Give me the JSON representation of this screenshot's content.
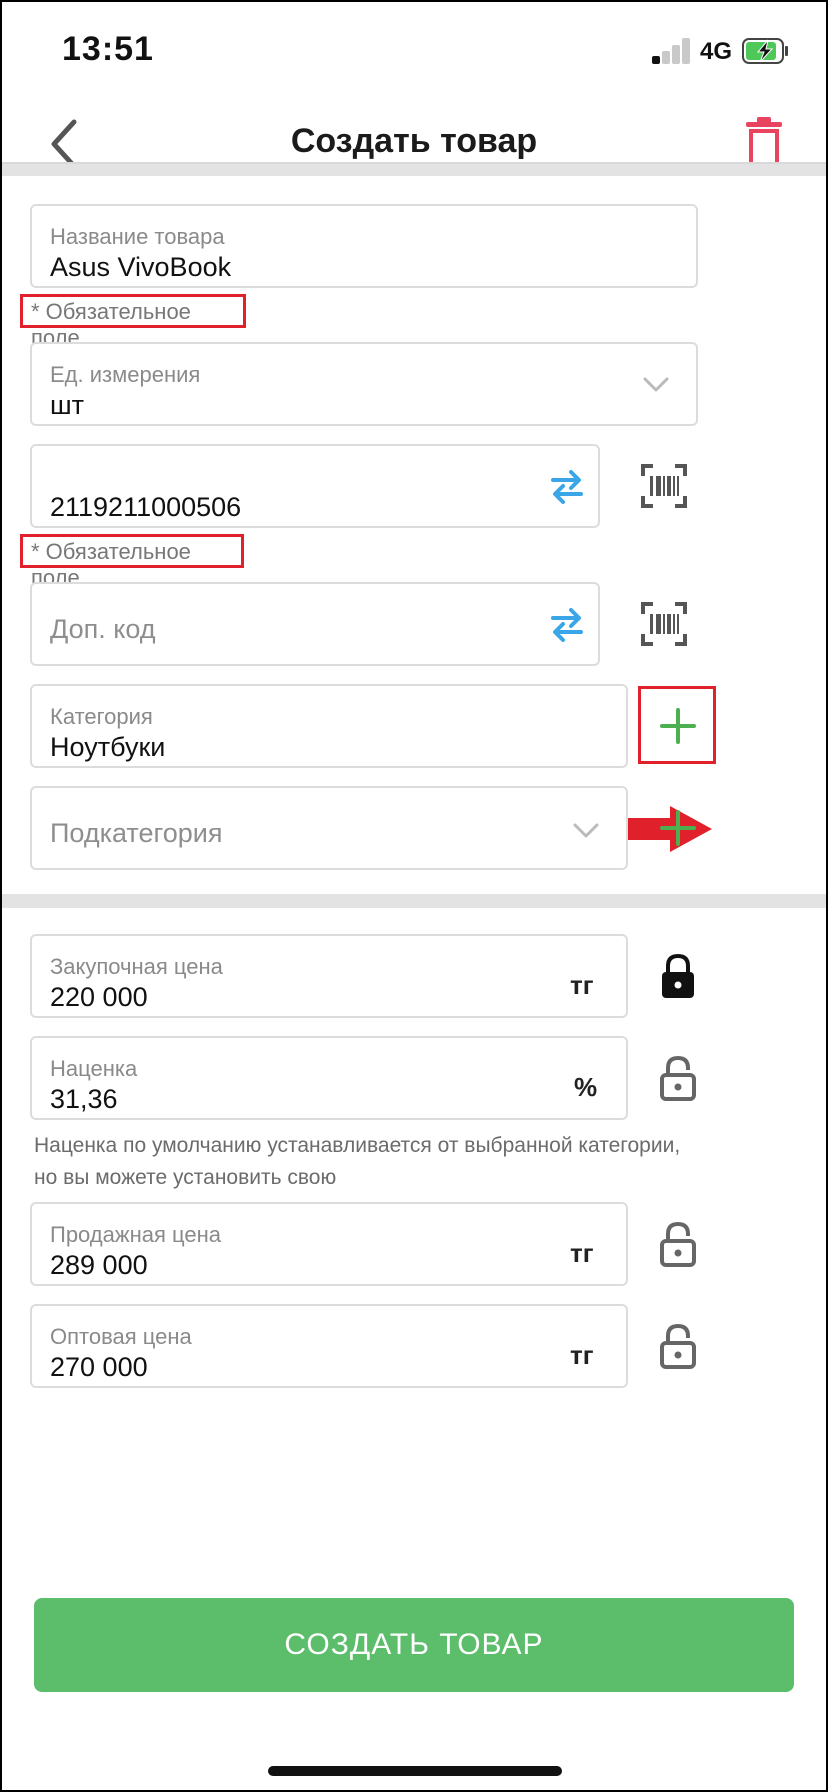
{
  "status_bar": {
    "time": "13:51",
    "network": "4G"
  },
  "header": {
    "title": "Создать товар"
  },
  "form": {
    "name": {
      "label": "Название товара",
      "value": "Asus VivoBook"
    },
    "name_required": "* Обязательное поле",
    "unit": {
      "label": "Ед. измерения",
      "value": "шт"
    },
    "barcode": {
      "value": "2119211000506"
    },
    "barcode_required": "* Обязательное поле",
    "extra_code": {
      "placeholder": "Доп. код"
    },
    "category": {
      "label": "Категория",
      "value": "Ноутбуки"
    },
    "subcategory": {
      "placeholder": "Подкатегория"
    },
    "purchase_price": {
      "label": "Закупочная цена",
      "value": "220 000",
      "suffix": "тг"
    },
    "markup": {
      "label": "Наценка",
      "value": "31,36",
      "suffix": "%"
    },
    "markup_hint": "Наценка по умолчанию устанавливается от выбранной категории, но вы можете установить свою",
    "sale_price": {
      "label": "Продажная цена",
      "value": "289 000",
      "suffix": "тг"
    },
    "wholesale_price": {
      "label": "Оптовая цена",
      "value": "270 000",
      "suffix": "тг"
    }
  },
  "actions": {
    "create_label": "СОЗДАТЬ ТОВАР"
  },
  "icons": {
    "back": "chevron-left-icon",
    "delete": "trash-icon",
    "dropdown": "chevron-down-icon",
    "swap": "swap-arrows-icon",
    "scan": "barcode-scan-icon",
    "add": "plus-icon",
    "lock": "lock-icon",
    "unlock": "unlock-icon",
    "annotation": "red-arrow-icon"
  },
  "colors": {
    "accent_green": "#5cbd6b",
    "delete_red": "#e8435f",
    "swap_blue": "#3aa6e8",
    "annotation_red": "#e0202a",
    "plus_green": "#4caf50"
  }
}
